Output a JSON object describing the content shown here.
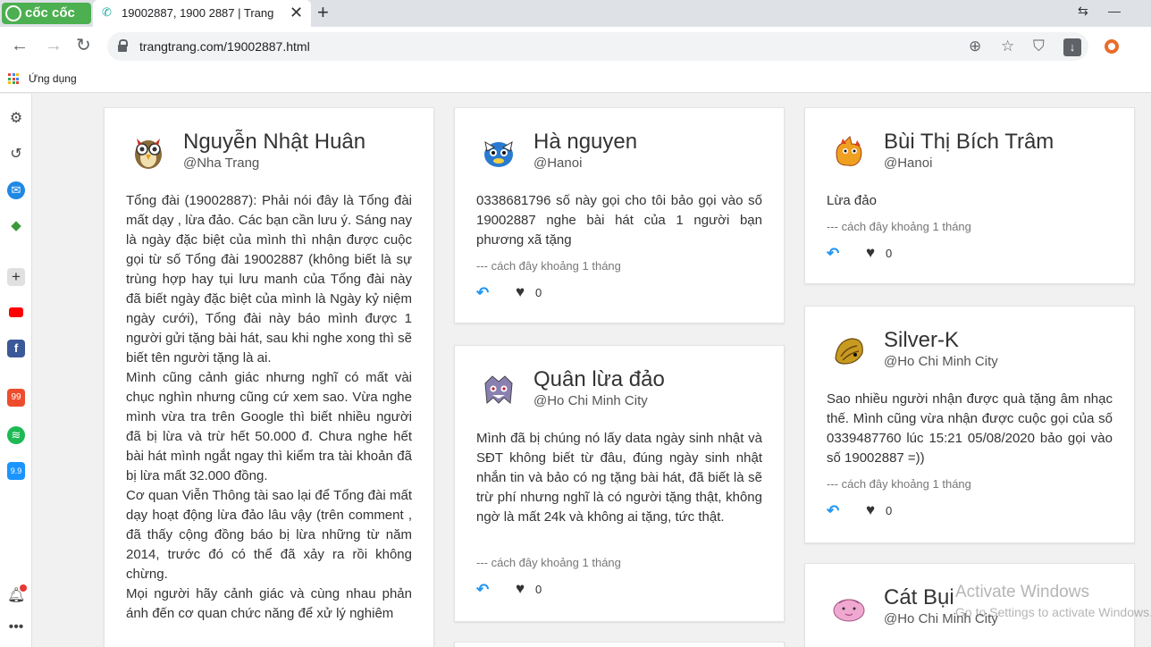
{
  "browser": {
    "brand": "cốc cốc",
    "tab_title": "19002887, 1900 2887 | Trang",
    "url": "trangtrang.com/19002887.html",
    "bookmark_apps": "Ứng dụng",
    "window_restore": "⇆",
    "window_minimize": "—"
  },
  "cards": [
    {
      "name": "Nguyễn Nhật Huân",
      "location": "@Nha Trang",
      "paragraphs": [
        "Tổng đài (19002887): Phải nói đây là Tổng đài mất dạy , lừa đảo. Các bạn cần lưu ý. Sáng nay là ngày đặc biệt của mình thì nhận được cuộc gọi từ số Tổng đài 19002887 (không biết là sự trùng hợp hay tụi lưu manh của Tổng đài này đã biết ngày đặc biệt của mình là Ngày kỷ niệm ngày cưới), Tổng đài này báo mình được 1 người gửi tặng bài hát, sau khi nghe xong thì sẽ biết tên người tặng là ai.",
        "Mình cũng cảnh giác nhưng nghĩ có mất vài chục nghìn nhưng cũng cứ xem sao. Vừa nghe mình vừa tra trên Google thì biết nhiều người đã bị lừa và trừ hết 50.000 đ. Chưa nghe hết bài hát mình ngắt ngay thì kiểm tra tài khoản đã bị lừa mất 32.000 đồng.",
        "Cơ quan Viễn Thông tài sao lại để Tổng đài mất dạy hoạt động lừa đảo lâu vậy (trên comment , đã thấy cộng đồng báo bị lừa những từ năm 2014, trước đó có thể đã xảy ra rồi không chừng.",
        "Mọi người hãy cảnh giác và cùng nhau phản ánh đến cơ quan chức năng để xử lý nghiêm"
      ]
    },
    {
      "name": "Hà nguyen",
      "location": "@Hanoi",
      "text": "0338681796 số này gọi cho tôi bảo gọi vào số 19002887 nghe bài hát của 1 người bạn phương xã tặng",
      "time": "--- cách đây khoảng 1 tháng",
      "likes": "0"
    },
    {
      "name": "Quân lừa đảo",
      "location": "@Ho Chi Minh City",
      "text": "Mình đã bị chúng nó lấy data ngày sinh nhật và SĐT không biết từ đâu, đúng ngày sinh nhật nhắn tin và bảo có ng tặng bài hát, đã biết là sẽ trừ phí nhưng nghĩ là có người tặng thật, không ngờ là mất 24k và không ai tặng, tức thật.",
      "time": "--- cách đây khoảng 1 tháng",
      "likes": "0"
    },
    {
      "name": "Bùi Thị Bích Trâm",
      "location": "@Hanoi",
      "text": "Lừa đảo",
      "time": "--- cách đây khoảng 1 tháng",
      "likes": "0"
    },
    {
      "name": "Silver-K",
      "location": "@Ho Chi Minh City",
      "text": "Sao nhiều người nhận được quà tặng âm nhạc thế. Mình cũng vừa nhận được cuộc gọi của số 0339487760 lúc 15:21 05/08/2020 bảo gọi vào số 19002887 =))",
      "time": "--- cách đây khoảng 1 tháng",
      "likes": "0"
    },
    {
      "name": "Cát Bụi",
      "location": "@Ho Chi Minh City"
    }
  ],
  "watermark": {
    "line1": "Activate Windows",
    "line2": "Go to Settings to activate Windows."
  },
  "icons": {
    "reply": "reply-arrow-icon",
    "like": "heart-icon"
  }
}
